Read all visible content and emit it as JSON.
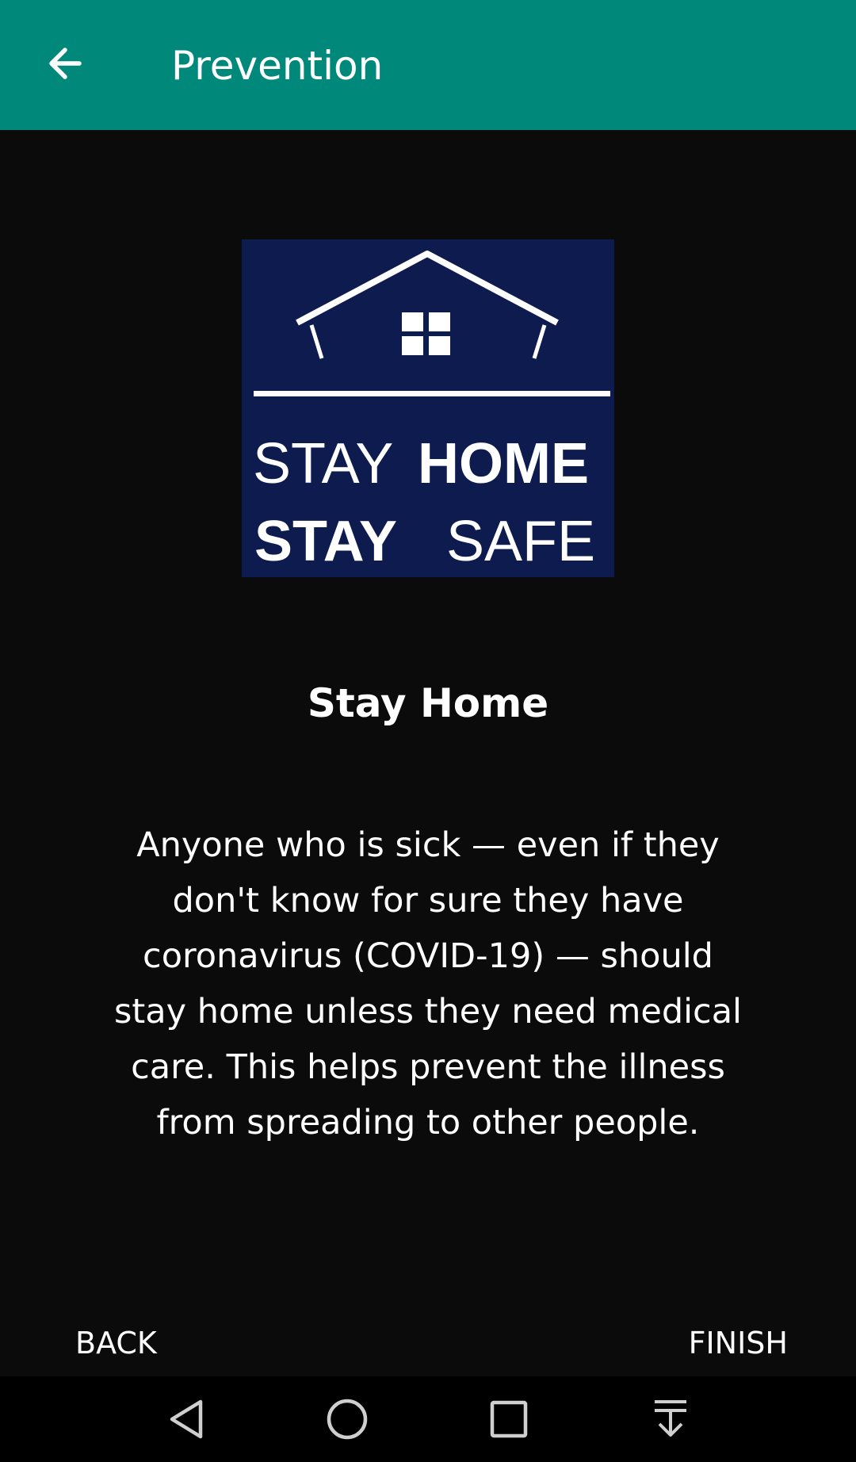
{
  "app_bar": {
    "title": "Prevention",
    "back_icon": "arrow-left-icon",
    "background_color": "#00897b"
  },
  "hero_image": {
    "description_icon": "house-icon",
    "background_color": "#0d1b4f",
    "line1_light": "STAY",
    "line1_bold": "HOME",
    "line2_bold": "STAY",
    "line2_light": "SAFE"
  },
  "content": {
    "heading": "Stay Home",
    "body": "Anyone who is sick — even if they don't know for sure they have coronavirus (COVID-19) — should stay home unless they need medical care. This helps prevent the illness from spreading to other people."
  },
  "footer": {
    "back_label": "BACK",
    "finish_label": "FINISH"
  },
  "system_nav": {
    "back_icon": "triangle-back-icon",
    "home_icon": "circle-home-icon",
    "recents_icon": "square-recents-icon",
    "notifications_icon": "pull-down-icon"
  }
}
